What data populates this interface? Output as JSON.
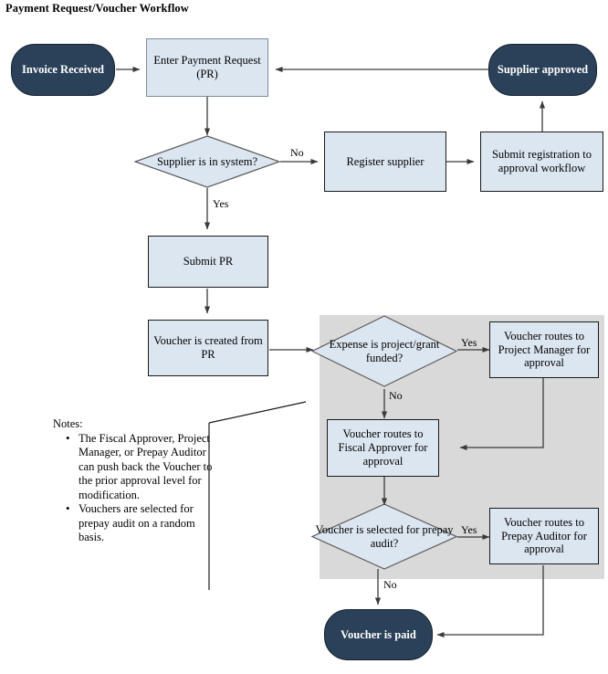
{
  "diagram": {
    "title": "Payment Request/Voucher Workflow",
    "colors": {
      "terminator_fill": "#2b4159",
      "process_fill": "#dce6f1",
      "shaded_region": "#d9d9d9",
      "border": "#1a1a1a",
      "text_light": "#ffffff",
      "text_dark": "#000000"
    }
  },
  "nodes": {
    "invoice_received": "Invoice Received",
    "enter_payment_request": "Enter Payment Request (PR)",
    "supplier_approved": "Supplier approved",
    "supplier_in_system": "Supplier is in system?",
    "register_supplier": "Register supplier",
    "submit_registration": "Submit registration to approval workflow",
    "submit_pr": "Submit PR",
    "voucher_created": "Voucher is created from PR",
    "expense_project_grant": "Expense is project/grant funded?",
    "routes_project_manager": "Voucher routes to Project Manager for approval",
    "routes_fiscal_approver": "Voucher routes to Fiscal Approver for approval",
    "selected_prepay_audit": "Voucher is selected for prepay audit?",
    "routes_prepay_auditor": "Voucher routes to Prepay Auditor for approval",
    "voucher_paid": "Voucher is paid"
  },
  "edge_labels": {
    "supplier_no": "No",
    "supplier_yes": "Yes",
    "expense_yes": "Yes",
    "expense_no": "No",
    "prepay_yes": "Yes",
    "prepay_no": "No"
  },
  "notes": {
    "heading": "Notes:",
    "items": [
      "The Fiscal Approver, Project Manager, or Prepay Auditor can push back the Voucher to the prior approval level for modification.",
      "Vouchers are selected for prepay audit on a random basis."
    ]
  }
}
